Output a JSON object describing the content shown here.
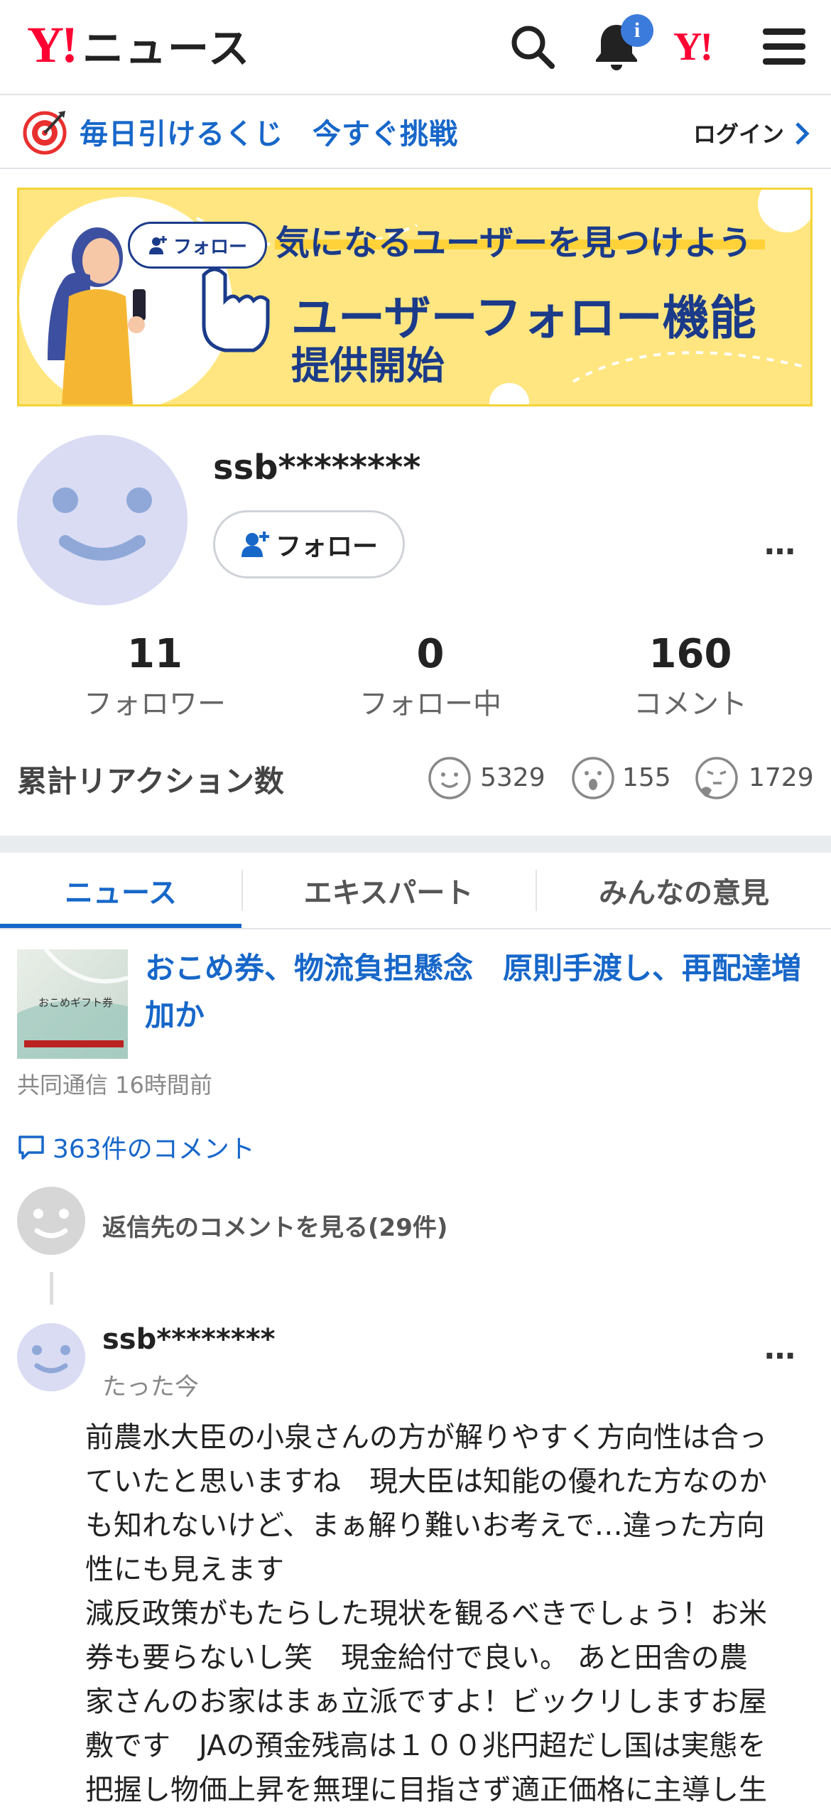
{
  "header": {
    "logo_y": "Y!",
    "logo_text": "ニュース",
    "notification_badge": "i",
    "yahoo_mini": "Y!"
  },
  "lottery": {
    "text": "毎日引けるくじ　今すぐ挑戦",
    "login": "ログイン"
  },
  "banner": {
    "pill": "フォロー",
    "line1": "気になるユーザーを見つけよう",
    "line2": "ユーザーフォロー機能",
    "line3": "提供開始"
  },
  "profile": {
    "username": "ssb********",
    "follow_button": "フォロー",
    "more": "…",
    "stats": [
      {
        "value": "11",
        "label": "フォロワー"
      },
      {
        "value": "0",
        "label": "フォロー中"
      },
      {
        "value": "160",
        "label": "コメント"
      }
    ],
    "reactions_title": "累計リアクション数",
    "reactions": [
      {
        "icon": "smile-icon",
        "count": "5329"
      },
      {
        "icon": "surprised-icon",
        "count": "155"
      },
      {
        "icon": "thinking-icon",
        "count": "1729"
      }
    ]
  },
  "tabs": [
    {
      "label": "ニュース",
      "active": true
    },
    {
      "label": "エキスパート",
      "active": false
    },
    {
      "label": "みんなの意見",
      "active": false
    }
  ],
  "article": {
    "thumb_caption": "おこめギフト券",
    "title": "おこめ券、物流負担懸念　原則手渡し、再配達増加か",
    "meta": "共同通信 16時間前",
    "comment_count": "363件のコメント",
    "reply_link": "返信先のコメントを見る(29件)"
  },
  "comment": {
    "user": "ssb********",
    "time": "たった今",
    "more": "…",
    "lines": [
      "前農水大臣の小泉さんの方が解りやすく方向性は合っ",
      "ていたと思いますね　現大臣は知能の優れた方なのか",
      "も知れないけど、まぁ解り難いお考えで…違った方向",
      "性にも見えます",
      "減反政策がもたらした現状を観るべきでしょう！お米",
      "券も要らないし笑　現金給付で良い。 あと田舎の農",
      "家さんのお家はまぁ立派ですよ！ビックリしますお屋",
      "敷です　JAの預金残高は１００兆円超だし国は実態を",
      "把握し物価上昇を無理に目指さず適正価格に主導し生"
    ]
  },
  "colors": {
    "brand_red": "#ff0033",
    "link_blue": "#1767c9",
    "banner_yellow": "#ffe680",
    "navy": "#1b3b8a"
  }
}
